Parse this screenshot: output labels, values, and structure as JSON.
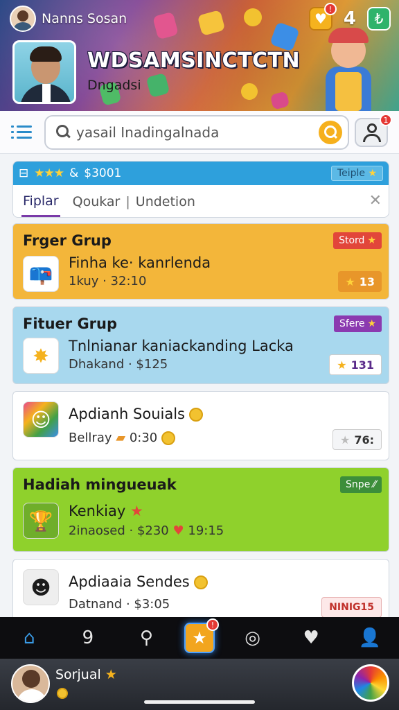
{
  "header": {
    "user_name": "Nanns Sosan",
    "count": "4",
    "gift_badge": "!",
    "banner_title": "WDSAMSINCTCTN",
    "banner_subtitle": "Dngadsi"
  },
  "search": {
    "query": "yasail Inadingalnada",
    "notification_badge": "1"
  },
  "filter": {
    "head_symbol": "&",
    "head_amount": "$3001",
    "tag_label": "Teiple",
    "tabs": [
      "Fiplar",
      "Qoukar",
      "Undetion"
    ]
  },
  "cards": [
    {
      "title": "Frger Grup",
      "pill": "Stord",
      "line1": "Finha ke· kanrlenda",
      "line2": "1kuy · 32:10",
      "score": "13",
      "bg": "#f3b63a"
    },
    {
      "title": "Fituer Grup",
      "pill": "Sfere",
      "line1": "Tnlnianar kaniackanding Lacka",
      "line2": "Dhakand · $125",
      "score": "131",
      "bg": "#a8d8ee"
    },
    {
      "title": "",
      "pill": "",
      "line1": "Apdianh Souials",
      "line2": "Bellray",
      "line2_extra": "0:30",
      "score": "76:",
      "bg": "#ffffff"
    },
    {
      "title": "Hadiah mingueuak",
      "pill": "Snpe",
      "line1": "Kenkiay",
      "line2": "2inaosed · $230",
      "line2_extra": "19:15",
      "score": "",
      "bg": "#8fd12c"
    },
    {
      "title": "",
      "pill": "",
      "line1": "Apdiaaia Sendes",
      "line2": "Datnand · $3:05",
      "score": "NINIG15",
      "bg": "#ffffff"
    }
  ],
  "nav": {
    "items": [
      "home-icon",
      "nine-icon",
      "search-icon",
      "star-icon",
      "compass-icon",
      "heart-icon",
      "user-icon"
    ],
    "center_badge": "!"
  },
  "user_bar": {
    "name": "Sorjual"
  }
}
